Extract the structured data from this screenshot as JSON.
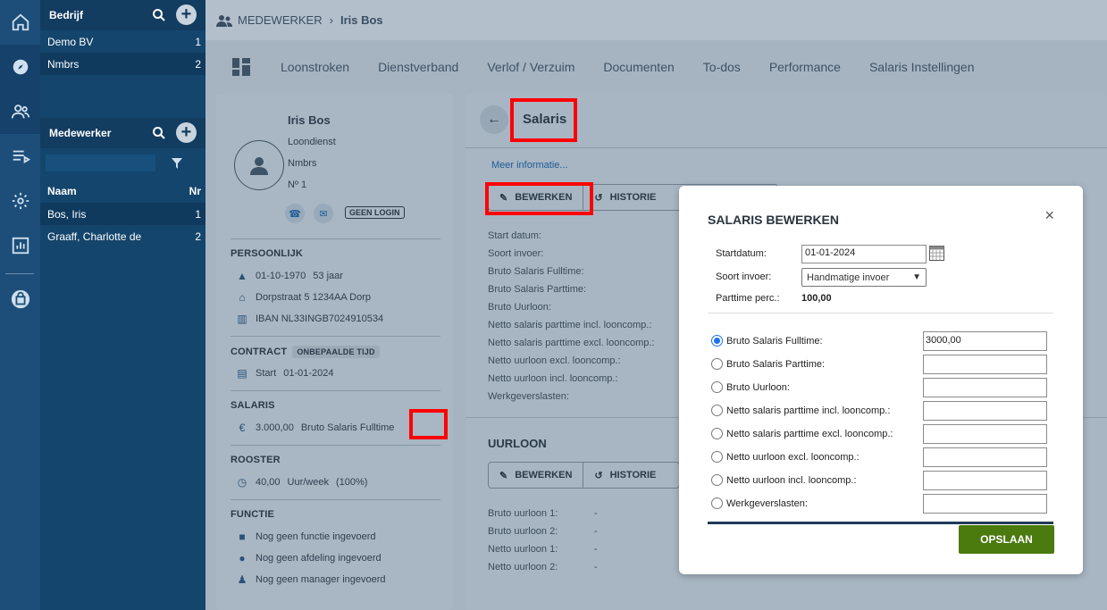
{
  "rail": {
    "items": [
      "home-icon",
      "compass-icon",
      "users-icon",
      "list-icon",
      "gear-icon",
      "chart-icon",
      "bag-icon"
    ]
  },
  "company": {
    "title": "Bedrijf",
    "rows": [
      {
        "name": "Demo BV",
        "count": "1"
      },
      {
        "name": "Nmbrs",
        "count": "2"
      }
    ]
  },
  "employees": {
    "title": "Medewerker",
    "col_name": "Naam",
    "col_nr": "Nr",
    "rows": [
      {
        "name": "Bos, Iris",
        "nr": "1"
      },
      {
        "name": "Graaff, Charlotte de",
        "nr": "2"
      }
    ]
  },
  "breadcrumb": {
    "section": "MEDEWERKER",
    "current": "Iris Bos"
  },
  "tabs": [
    "Loonstroken",
    "Dienstverband",
    "Verlof / Verzuim",
    "Documenten",
    "To-dos",
    "Performance",
    "Salaris Instellingen"
  ],
  "profile": {
    "name": "Iris Bos",
    "type": "Loondienst",
    "company": "Nmbrs",
    "number": "Nº 1",
    "no_login": "GEEN LOGIN"
  },
  "personal": {
    "title": "PERSOONLIJK",
    "birth": "01-10-1970",
    "age": "53 jaar",
    "address": "Dorpstraat 5 1234AA Dorp",
    "iban": "IBAN NL33INGB7024910534"
  },
  "contract": {
    "title": "CONTRACT",
    "badge": "ONBEPAALDE TIJD",
    "start_label": "Start",
    "start": "01-01-2024"
  },
  "salary_left": {
    "title": "SALARIS",
    "amount": "3.000,00",
    "type": "Bruto Salaris Fulltime"
  },
  "roster": {
    "title": "ROOSTER",
    "hours": "40,00",
    "unit": "Uur/week",
    "pct": "(100%)"
  },
  "function": {
    "title": "FUNCTIE",
    "f1": "Nog geen functie ingevoerd",
    "f2": "Nog geen afdeling ingevoerd",
    "f3": "Nog geen manager ingevoerd"
  },
  "salaris": {
    "title": "Salaris",
    "more_info": "Meer informatie...",
    "edit": "BEWERKEN",
    "history": "HISTORIE",
    "fields": [
      "Start datum:",
      "Soort invoer:",
      "Bruto Salaris Fulltime:",
      "Bruto Salaris Parttime:",
      "Bruto Uurloon:",
      "Netto salaris parttime incl. looncomp.:",
      "Netto salaris parttime excl. looncomp.:",
      "Netto uurloon excl. looncomp.:",
      "Netto uurloon incl. looncomp.:",
      "Werkgeverslasten:"
    ]
  },
  "uurloon": {
    "title": "UURLOON",
    "edit": "BEWERKEN",
    "history": "HISTORIE",
    "rows": [
      {
        "label": "Bruto uurloon 1:",
        "val": "-"
      },
      {
        "label": "Bruto uurloon 2:",
        "val": "-"
      },
      {
        "label": "Netto uurloon 1:",
        "val": "-"
      },
      {
        "label": "Netto uurloon 2:",
        "val": "-"
      }
    ]
  },
  "modal": {
    "title": "SALARIS BEWERKEN",
    "start_label": "Startdatum:",
    "start_value": "01-01-2024",
    "type_label": "Soort invoer:",
    "type_value": "Handmatige invoer",
    "pt_label": "Parttime perc.:",
    "pt_value": "100,00",
    "options": [
      {
        "label": "Bruto Salaris Fulltime:",
        "value": "3000,00"
      },
      {
        "label": "Bruto Salaris Parttime:",
        "value": ""
      },
      {
        "label": "Bruto Uurloon:",
        "value": ""
      },
      {
        "label": "Netto salaris parttime incl. looncomp.:",
        "value": ""
      },
      {
        "label": "Netto salaris parttime excl. looncomp.:",
        "value": ""
      },
      {
        "label": "Netto uurloon excl. looncomp.:",
        "value": ""
      },
      {
        "label": "Netto uurloon incl. looncomp.:",
        "value": ""
      },
      {
        "label": "Werkgeverslasten:",
        "value": ""
      }
    ],
    "save": "OPSLAAN"
  }
}
